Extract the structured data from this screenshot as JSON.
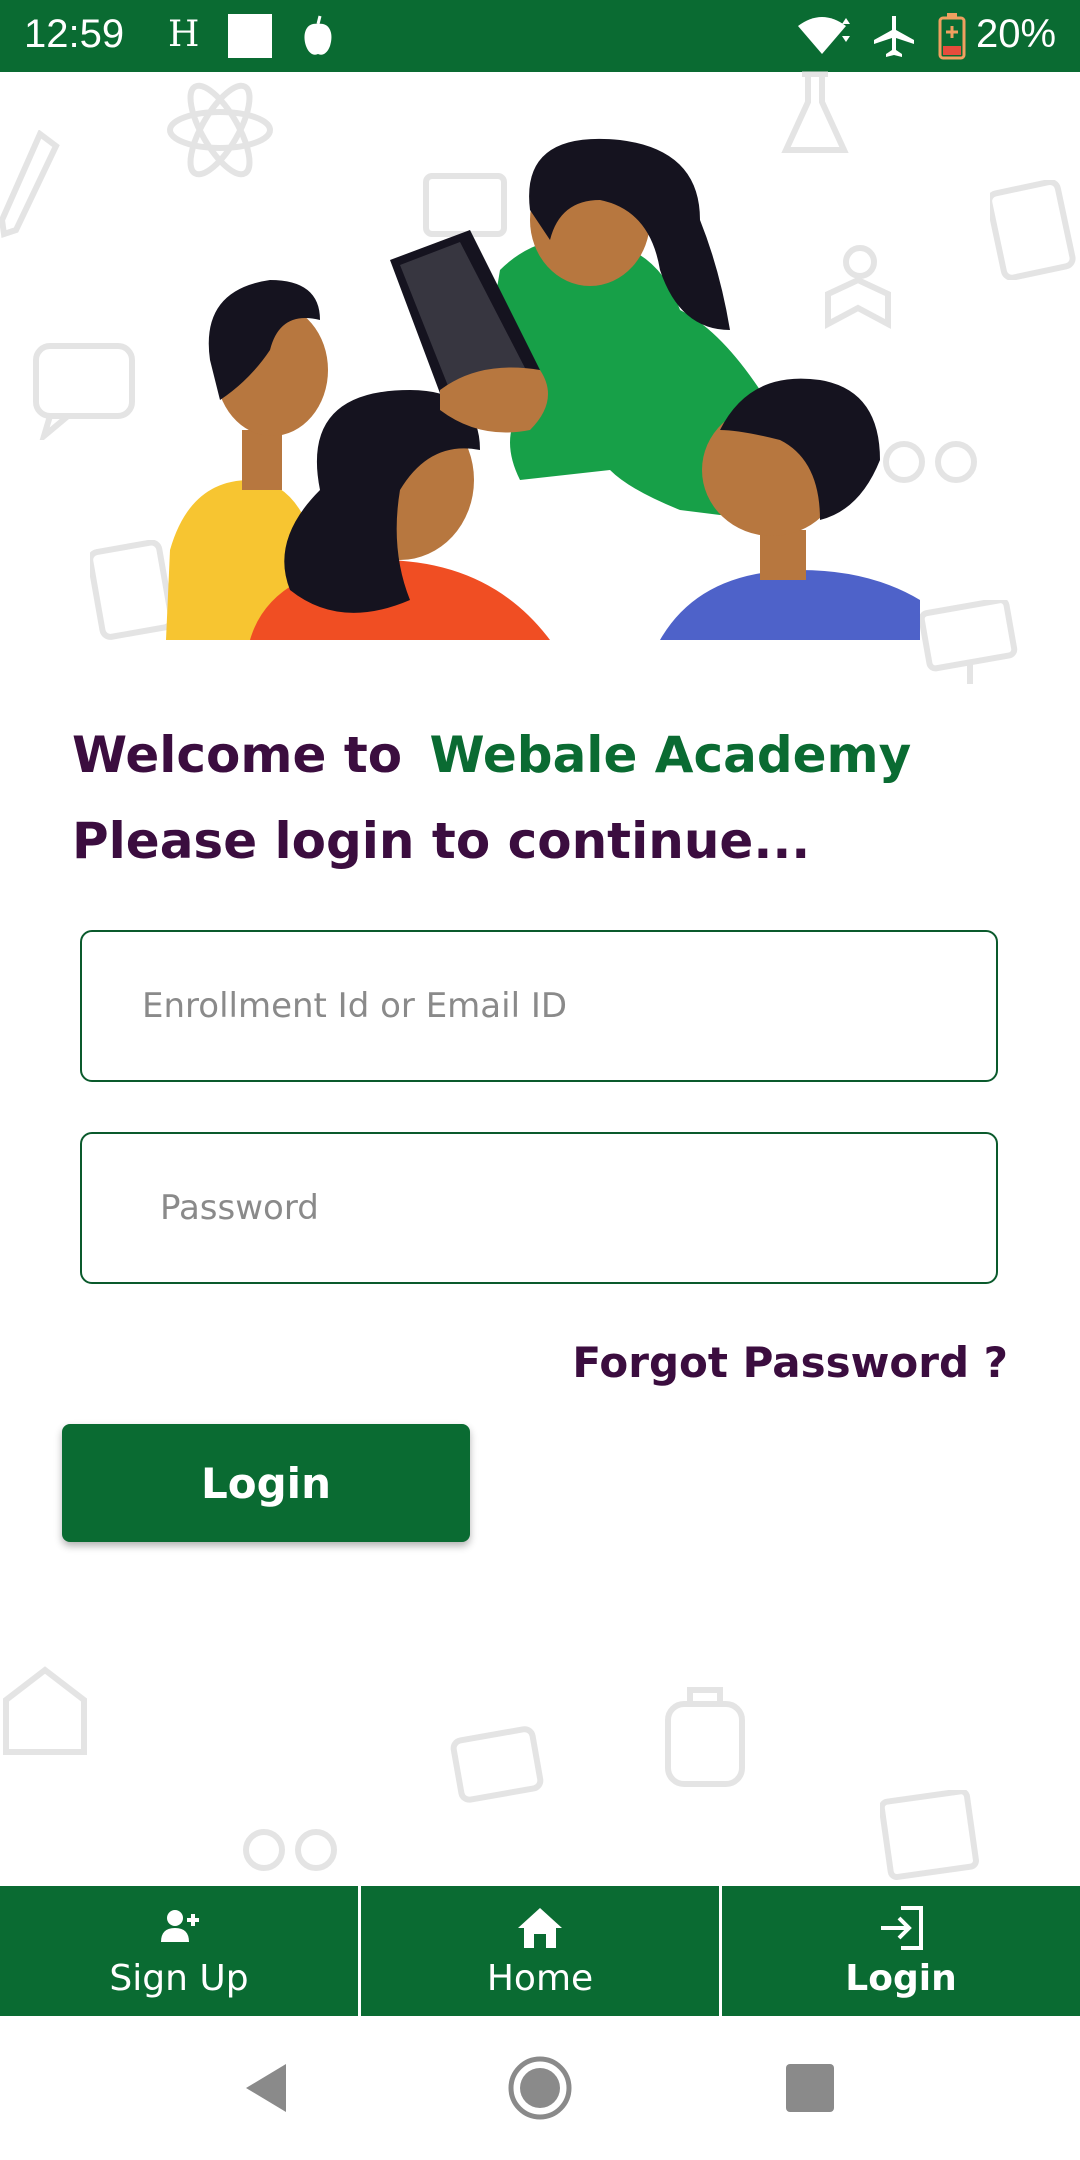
{
  "status_bar": {
    "time": "12:59",
    "h_label": "H",
    "battery": "20%",
    "icons": [
      "square-icon",
      "apple-icon",
      "wifi-icon",
      "airplane-mode-icon",
      "battery-icon"
    ]
  },
  "welcome": {
    "prefix": "Welcome to",
    "brand": "Webale Academy",
    "subtitle": "Please login to continue..."
  },
  "form": {
    "email_placeholder": "Enrollment Id or Email ID",
    "email_value": "",
    "password_placeholder": "Password",
    "password_value": "",
    "forgot_label": "Forgot Password ?",
    "login_label": "Login"
  },
  "bottom_nav": {
    "tabs": [
      {
        "label": "Sign Up",
        "icon": "add-user-icon"
      },
      {
        "label": "Home",
        "icon": "home-icon"
      },
      {
        "label": "Login",
        "icon": "login-icon",
        "active": true
      }
    ]
  },
  "system_nav": {
    "icons": [
      "back-icon",
      "home-circle-icon",
      "recents-icon"
    ]
  },
  "colors": {
    "primary_green": "#0a6b32",
    "title_purple": "#3b0d3f",
    "white": "#ffffff"
  }
}
